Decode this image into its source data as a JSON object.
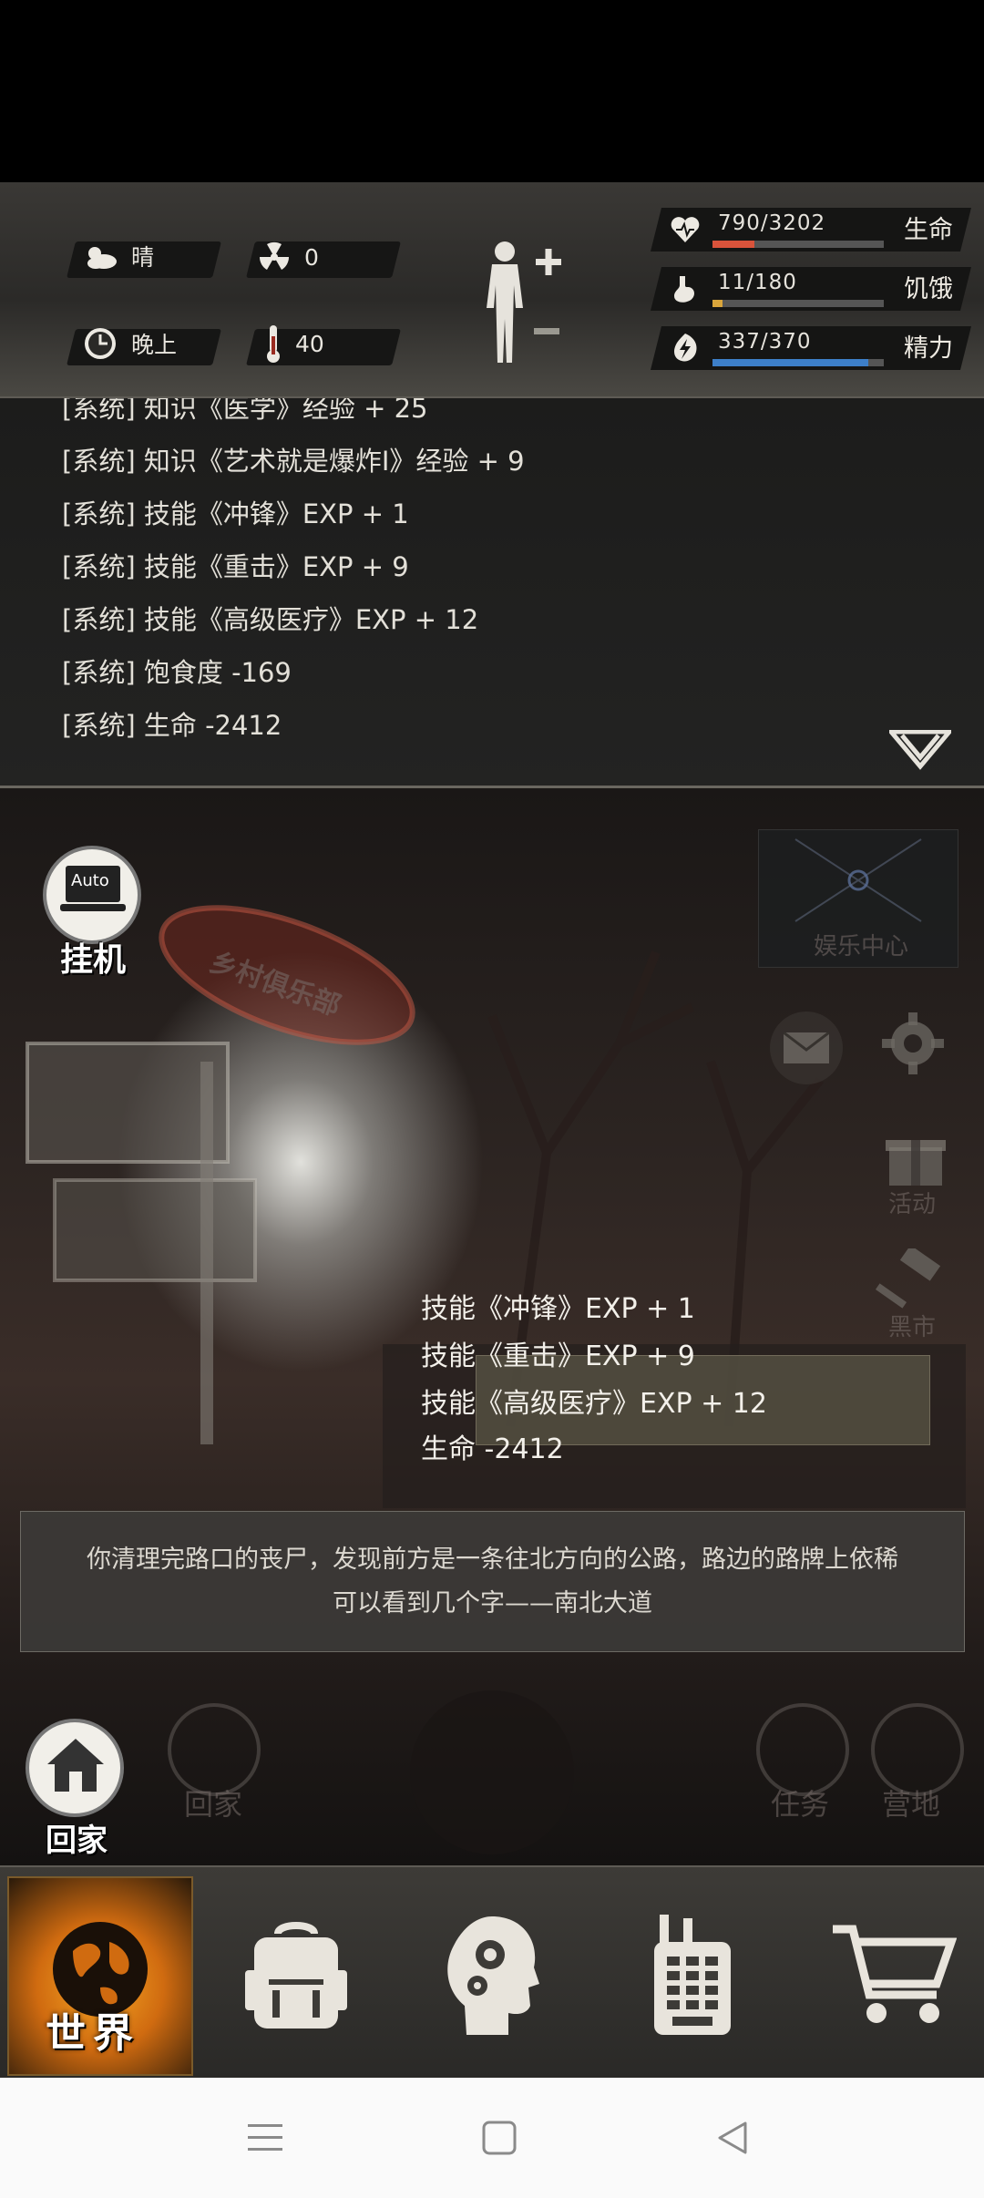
{
  "status": {
    "weather": {
      "icon": "cloud-sun-icon",
      "label": "晴"
    },
    "radiation": {
      "icon": "radiation-icon",
      "value": "0"
    },
    "time": {
      "icon": "clock-icon",
      "label": "晚上"
    },
    "temperature": {
      "icon": "thermometer-icon",
      "value": "40"
    },
    "vitals": [
      {
        "key": "life",
        "icon": "heart-icon",
        "value": "790/3202",
        "label": "生命",
        "fraction": 0.247,
        "color": "#d9533b"
      },
      {
        "key": "hunger",
        "icon": "stomach-icon",
        "value": "11/180",
        "label": "饥饿",
        "fraction": 0.061,
        "color": "#d9a53b"
      },
      {
        "key": "energy",
        "icon": "energy-icon",
        "value": "337/370",
        "label": "精力",
        "fraction": 0.911,
        "color": "#3d7fc9"
      }
    ]
  },
  "log": {
    "lines": [
      "[系统] 知识《医学》经验 + 25",
      "[系统] 知识《艺术就是爆炸Ⅰ》经验 + 9",
      "[系统] 技能《冲锋》EXP + 1",
      "[系统] 技能《重击》EXP + 9",
      "[系统] 技能《高级医疗》EXP + 12",
      "[系统] 饱食度 -169",
      "[系统] 生命 -2412"
    ]
  },
  "scene": {
    "auto_label": "Auto",
    "idle_label": "挂机",
    "entertainment_label": "娱乐中心",
    "sign_text": "乡村俱乐部",
    "events_label": "活动",
    "black_market_label": "黑市",
    "popup": [
      "技能《冲锋》EXP + 1",
      "技能《重击》EXP + 9",
      "技能《高级医疗》EXP + 12",
      "生命 -2412"
    ],
    "story": "你清理完路口的丧尸，发现前方是一条往北方向的公路，路边的路牌上依稀可以看到几个字——南北大道",
    "home_label": "回家",
    "home_faint_label": "回家",
    "task_label": "任务",
    "camp_label": "营地"
  },
  "nav": {
    "world_label": "世界"
  }
}
